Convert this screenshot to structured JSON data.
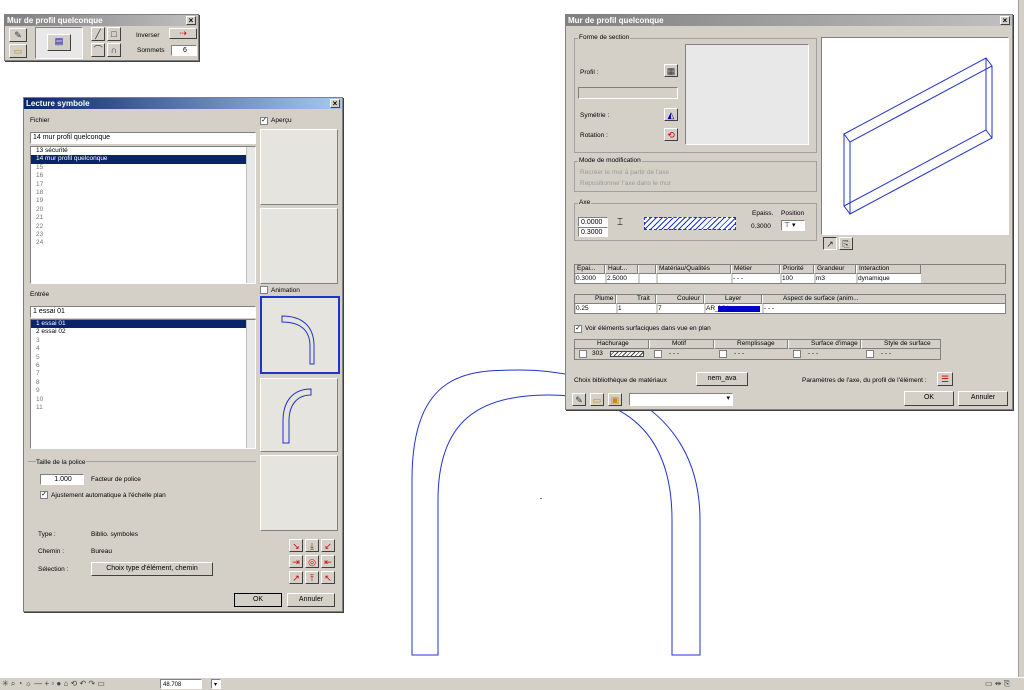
{
  "small_window": {
    "title": "Mur de profil quelconque",
    "inverser_label": "Inverser",
    "sommets_label": "Sommets",
    "sommets_value": "6"
  },
  "lecture": {
    "title": "Lecture symbole",
    "fichier_label": "Fichier",
    "apercu_label": "Aperçu",
    "fichier_value": "14 mur profil quelconque",
    "files": [
      "13 sécurité",
      "14 mur profil quelconque",
      "15",
      "16",
      "17",
      "18",
      "19",
      "20",
      "21",
      "22",
      "23",
      "24"
    ],
    "entree_label": "Entrée",
    "animation_label": "Animation",
    "entree_value": "1 essai 01",
    "entries": [
      "1 essai 01",
      "2 essai 02",
      "3",
      "4",
      "5",
      "6",
      "7",
      "8",
      "9",
      "10",
      "11"
    ],
    "taille_label": "Taille de la police",
    "facteur_value": "1.000",
    "facteur_label": "Facteur de police",
    "ajust_label": "Ajustement automatique à l'échelle plan",
    "type_label": "Type :",
    "type_value": "Biblio. symboles",
    "chemin_label": "Chemin :",
    "chemin_value": "Bureau",
    "selection_label": "Sélection :",
    "choix_button": "Choix type d'élément, chemin",
    "ok": "OK",
    "annuler": "Annuler"
  },
  "mur": {
    "title": "Mur de profil quelconque",
    "forme_label": "Forme de section",
    "profil_label": "Profil :",
    "symetrie_label": "Symétrie :",
    "rotation_label": "Rotation :",
    "mode_label": "Mode de modification",
    "mode_opt1": "Recréer le mur à partir de l'axe",
    "mode_opt2": "Repositionner l'axe dans le mur",
    "axe_label": "Axe",
    "axe_v1": "0.0000",
    "axe_v2": "0.3000",
    "epaiss_label": "Epaiss.",
    "epaiss_value": "0.3000",
    "position_label": "Position",
    "t1_headers": [
      "Epai...",
      "Haut...",
      "",
      "Matériau/Qualités",
      "Métier",
      "Priorité",
      "Grandeur",
      "Interaction"
    ],
    "t1_values": [
      "0.3000",
      "2.5000",
      "",
      "",
      "- - -",
      "100",
      "m3",
      "dynamique"
    ],
    "t2_headers": [
      "Plume",
      "Trait",
      "Couleur",
      "Layer",
      "Aspect de surface (anim..."
    ],
    "t2_values": [
      "0.25",
      "1",
      "7",
      "AR_MU",
      "- - -"
    ],
    "voir_label": "Voir éléments surfaciques dans vue en plan",
    "t3_headers": [
      "Hachurage",
      "Motif",
      "Remplissage",
      "Surface d'image",
      "Style de surface"
    ],
    "t3_hach_value": "303",
    "t3_dash": "- - -",
    "choix_label": "Choix bibliothèque de matériaux",
    "nem_button": "nem_ava",
    "params_label": "Paramètres de l'axe, du profil de l'élément :",
    "ok": "OK",
    "annuler": "Annuler",
    "accent_color": "#0000cc"
  },
  "statusbar": {
    "zoom_value": "48.708"
  }
}
